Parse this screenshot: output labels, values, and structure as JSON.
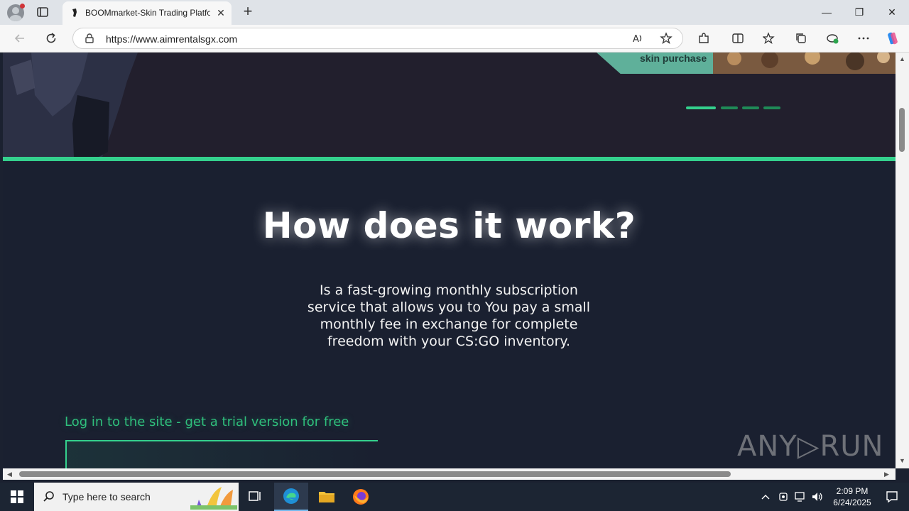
{
  "browser": {
    "tab_title": "BOOMmarket-Skin Trading Platfo",
    "url": "https://www.aimrentalsgx.com",
    "new_tab_symbol": "+",
    "close_tab_symbol": "✕",
    "window_controls": {
      "minimize": "—",
      "restore": "❐",
      "close": "✕"
    }
  },
  "hero": {
    "promo_text": "skin purchase",
    "carousel_dots": 4,
    "active_dot": 0
  },
  "section": {
    "title": "How does it work?",
    "description": "Is a fast-growing monthly subscription service that allows you to You pay a small monthly fee in exchange for complete freedom with your CS:GO inventory.",
    "cta_text": "Log in to the site - get a trial version for free"
  },
  "watermark": "ANY▷RUN",
  "taskbar": {
    "search_placeholder": "Type here to search",
    "time": "2:09 PM",
    "date": "6/24/2025"
  },
  "colors": {
    "accent_green": "#34d08d",
    "page_bg": "#1a2030",
    "hero_bg": "#221f2d",
    "promo_bg": "#5fb09a"
  }
}
